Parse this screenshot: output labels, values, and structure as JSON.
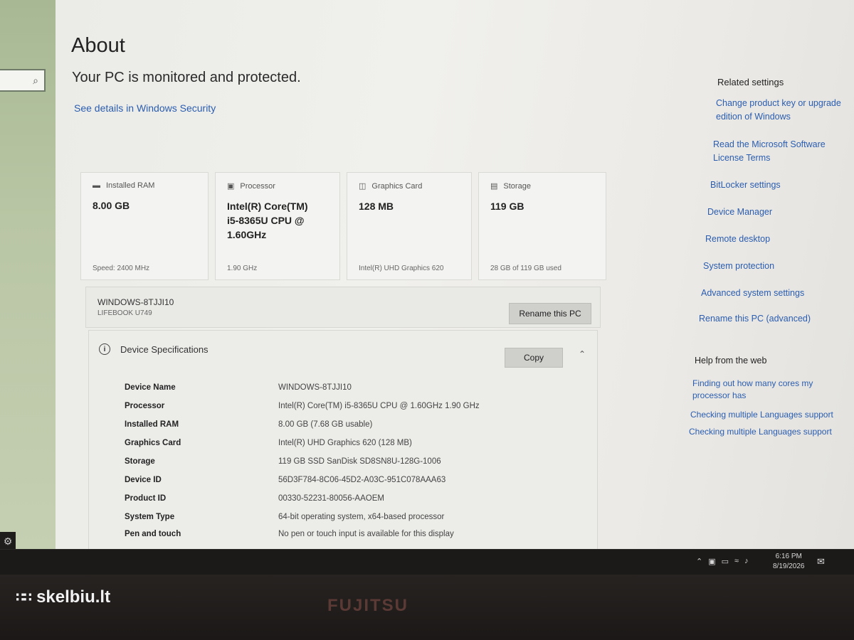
{
  "search": {
    "icon": "search-icon"
  },
  "header": {
    "title": "About",
    "protection_text": "Your PC is monitored and protected.",
    "security_link": "See details in Windows Security"
  },
  "tiles": [
    {
      "label": "Installed RAM",
      "icon": "ram-icon",
      "value": "8.00 GB",
      "footer": "Speed: 2400 MHz"
    },
    {
      "label": "Processor",
      "icon": "processor-icon",
      "value": "Intel(R) Core(TM) i5-8365U CPU @ 1.60GHz",
      "footer": "1.90 GHz"
    },
    {
      "label": "Graphics Card",
      "icon": "graphics-card-icon",
      "value": "128 MB",
      "footer": "Intel(R) UHD Graphics 620"
    },
    {
      "label": "Storage",
      "icon": "storage-icon",
      "value": "119 GB",
      "footer": "28 GB of 119 GB used"
    }
  ],
  "pc": {
    "name": "WINDOWS-8TJJI10",
    "model": "LIFEBOOK U749",
    "rename_button": "Rename this PC"
  },
  "specs": {
    "header": "Device Specifications",
    "copy_button": "Copy",
    "rows": [
      {
        "label": "Device Name",
        "value": "WINDOWS-8TJJI10"
      },
      {
        "label": "Processor",
        "value": "Intel(R) Core(TM) i5-8365U CPU @ 1.60GHz   1.90 GHz"
      },
      {
        "label": "Installed RAM",
        "value": "8.00 GB (7.68 GB usable)"
      },
      {
        "label": "Graphics Card",
        "value": "Intel(R) UHD Graphics 620 (128 MB)"
      },
      {
        "label": "Storage",
        "value": "119 GB SSD SanDisk SD8SN8U-128G-1006"
      },
      {
        "label": "Device ID",
        "value": "56D3F784-8C06-45D2-A03C-951C078AAA63"
      },
      {
        "label": "Product ID",
        "value": "00330-52231-80056-AAOEM"
      },
      {
        "label": "System Type",
        "value": "64-bit operating system, x64-based processor"
      },
      {
        "label": "Pen and touch",
        "value": "No pen or touch input is available for this display"
      }
    ]
  },
  "related": {
    "heading": "Related settings",
    "links": [
      "Change product key or upgrade edition of Windows",
      "Read the Microsoft Software License Terms",
      "BitLocker settings",
      "Device Manager",
      "Remote desktop",
      "System protection",
      "Advanced system settings",
      "Rename this PC (advanced)"
    ]
  },
  "help": {
    "heading": "Help from the web",
    "links": [
      "Finding out how many cores my processor has",
      "Checking multiple Languages support",
      "Checking multiple Languages support"
    ]
  },
  "taskbar": {
    "time": "6:16 PM",
    "date": "8/19/2026",
    "tray_icons": [
      "chevron-up-icon",
      "network-icon",
      "battery-icon",
      "wifi-icon",
      "volume-icon"
    ],
    "notification_icon": "notification-icon"
  },
  "bezel": {
    "brand": "FUJITSU",
    "watermark": "skelbiu.lt"
  }
}
